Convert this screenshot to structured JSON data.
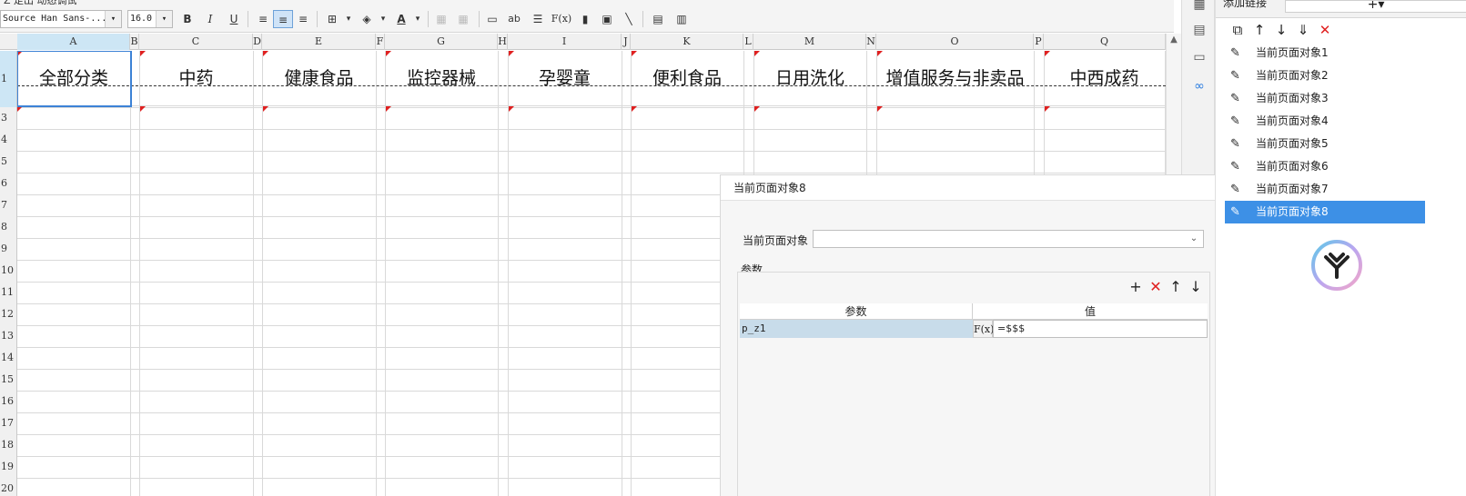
{
  "toolbar": {
    "top_strip_text": "Z  走出 动态调试",
    "font_family": "Source Han Sans-...",
    "font_size": "16.0",
    "bold": "B",
    "italic": "I",
    "underline": "U",
    "fx": "F(x)",
    "ab": "ab"
  },
  "sheet": {
    "columns": [
      "A",
      "B",
      "C",
      "D",
      "E",
      "F",
      "G",
      "H",
      "I",
      "J",
      "K",
      "L",
      "M",
      "N",
      "O",
      "P",
      "Q"
    ],
    "rows": [
      "1",
      "3",
      "4",
      "5",
      "6",
      "7",
      "8",
      "9",
      "10",
      "11",
      "12",
      "13",
      "14",
      "15",
      "16",
      "17",
      "18",
      "19",
      "20"
    ],
    "row1_cells": [
      "全部分类",
      "中药",
      "健康食品",
      "监控器械",
      "孕婴童",
      "便利食品",
      "日用洗化",
      "增值服务与非卖品",
      "中西成药"
    ]
  },
  "dialog": {
    "title": "当前页面对象8",
    "object_label": "当前页面对象",
    "object_value": "",
    "params_label": "参数",
    "table_head_param": "参数",
    "table_head_value": "值",
    "param_rows": [
      {
        "name": "p_z1",
        "fx": "F(x)",
        "value": "=$$$"
      }
    ]
  },
  "right_panel": {
    "title": "添加链接",
    "add_symbol": "+▾",
    "items": [
      "当前页面对象1",
      "当前页面对象2",
      "当前页面对象3",
      "当前页面对象4",
      "当前页面对象5",
      "当前页面对象6",
      "当前页面对象7",
      "当前页面对象8"
    ],
    "selected_index": 7
  },
  "colors": {
    "accent": "#3d90e6",
    "selection_border": "#3c82d6",
    "delete_red": "#e02020"
  }
}
